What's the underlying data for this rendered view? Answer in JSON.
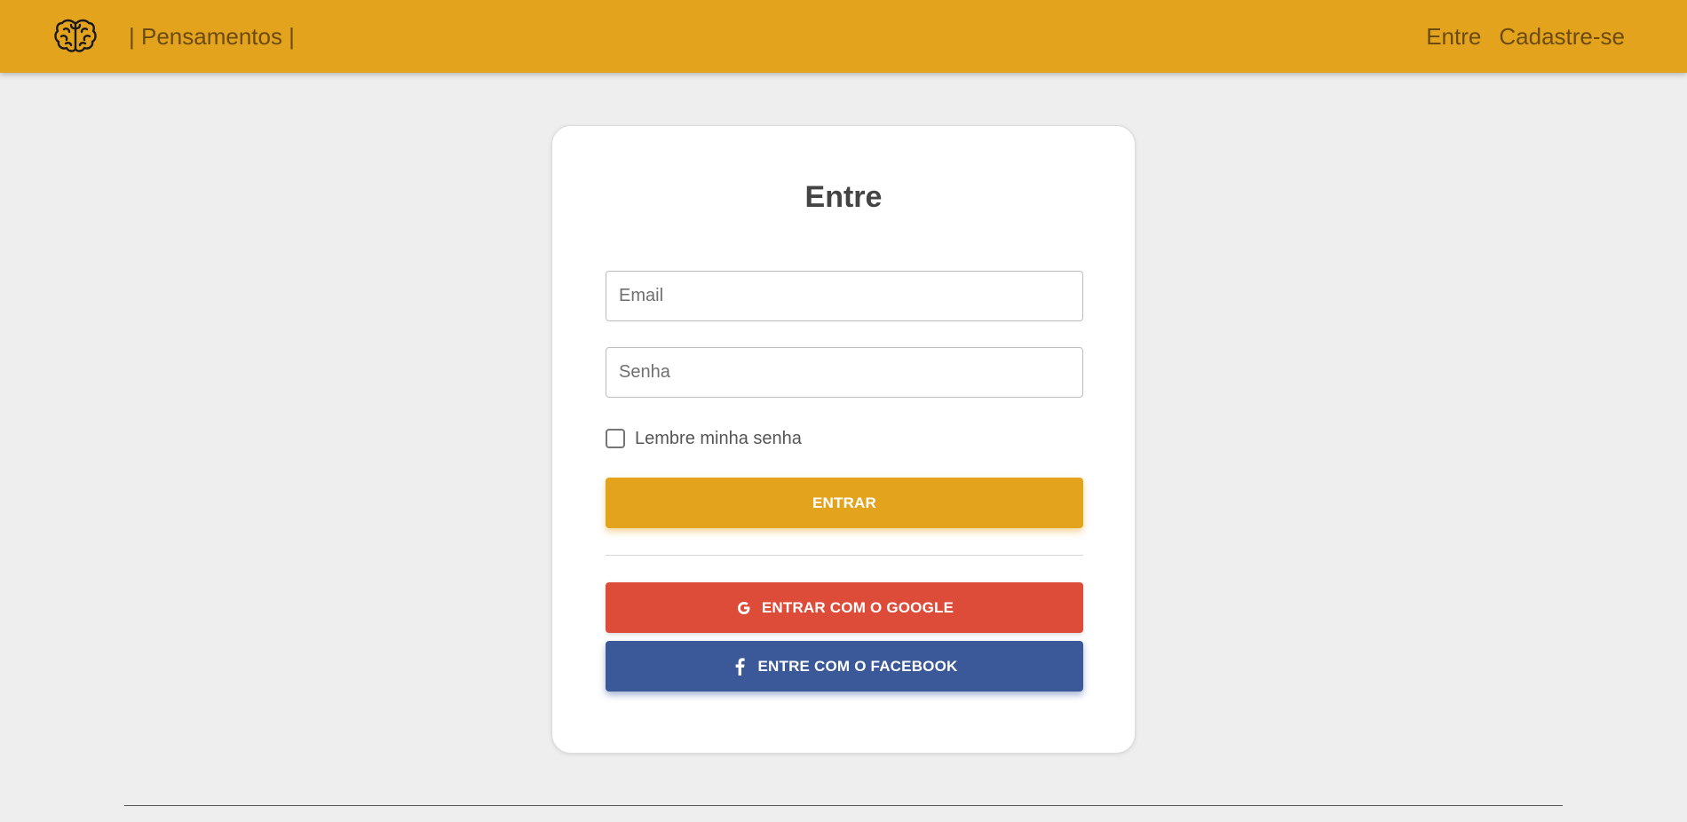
{
  "navbar": {
    "logo_icon": "brain-icon",
    "brand_text": "| Pensamentos |",
    "links": [
      {
        "label": "Entre"
      },
      {
        "label": "Cadastre-se"
      }
    ],
    "background_color": "#e4a31d"
  },
  "login": {
    "title": "Entre",
    "email_placeholder": "Email",
    "password_placeholder": "Senha",
    "remember_label": "Lembre minha senha",
    "remember_checked": false,
    "submit_label": "ENTRAR",
    "google_label": "ENTRAR COM O GOOGLE",
    "google_icon": "google-icon",
    "facebook_label": "ENTRE COM O FACEBOOK",
    "facebook_icon": "facebook-icon"
  },
  "colors": {
    "accent": "#e4a31d",
    "google": "#dd4b39",
    "facebook": "#3b5998",
    "page_background": "#eeeeee"
  }
}
